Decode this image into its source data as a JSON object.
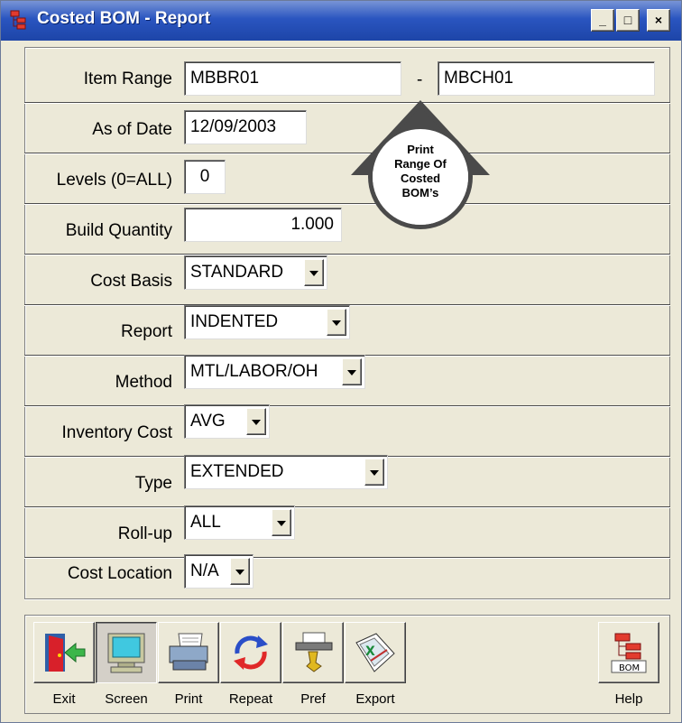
{
  "window": {
    "title": "Costed BOM - Report",
    "minimize": "_",
    "maximize": "□",
    "close": "×"
  },
  "form": {
    "item_range": {
      "label": "Item Range",
      "from": "MBBR01",
      "separator": "-",
      "to": "MBCH01"
    },
    "as_of_date": {
      "label": "As of Date",
      "value": "12/09/2003"
    },
    "levels": {
      "label": "Levels (0=ALL)",
      "value": "0"
    },
    "build_quantity": {
      "label": "Build Quantity",
      "value": "1.000"
    },
    "cost_basis": {
      "label": "Cost Basis",
      "value": "STANDARD"
    },
    "report": {
      "label": "Report",
      "value": "INDENTED"
    },
    "method": {
      "label": "Method",
      "value": "MTL/LABOR/OH"
    },
    "inventory_cost": {
      "label": "Inventory Cost",
      "value": "AVG"
    },
    "type": {
      "label": "Type",
      "value": "EXTENDED"
    },
    "rollup": {
      "label": "Roll-up",
      "value": "ALL"
    },
    "cost_location": {
      "label": "Cost Location",
      "value": "N/A"
    }
  },
  "callout": {
    "line1": "Print",
    "line2": "Range Of",
    "line3": "Costed",
    "line4": "BOM’s"
  },
  "toolbar": {
    "exit": "Exit",
    "screen": "Screen",
    "print": "Print",
    "repeat": "Repeat",
    "pref": "Pref",
    "export": "Export",
    "help": "Help",
    "help_icon_text": "BOM"
  },
  "colors": {
    "titlebar": "#2a55c0",
    "face": "#ece9d8"
  }
}
